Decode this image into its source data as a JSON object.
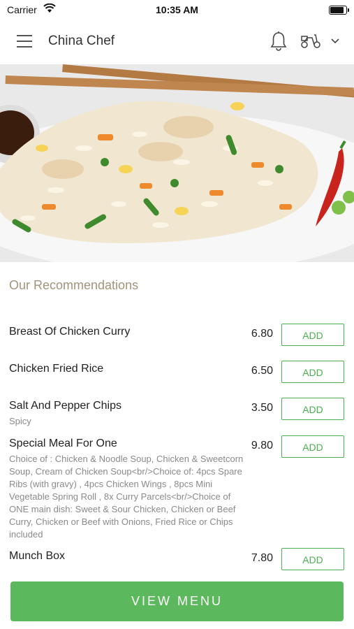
{
  "status_bar": {
    "carrier": "Carrier",
    "time": "10:35 AM"
  },
  "header": {
    "title": "China Chef"
  },
  "icons": {
    "menu": "hamburger-menu-icon",
    "notification": "bell-icon",
    "delivery": "scooter-icon",
    "dropdown": "chevron-down-icon",
    "wifi": "wifi-icon",
    "battery": "battery-icon"
  },
  "section_title": "Our Recommendations",
  "items": [
    {
      "name": "Breast Of Chicken Curry",
      "description": "",
      "price": "6.80",
      "action": "ADD"
    },
    {
      "name": "Chicken Fried Rice",
      "description": "",
      "price": "6.50",
      "action": "ADD"
    },
    {
      "name": "Salt And Pepper Chips",
      "description": "Spicy",
      "price": "3.50",
      "action": "ADD"
    },
    {
      "name": "Special Meal For One",
      "description": "Choice of : Chicken & Noodle Soup, Chicken & Sweetcorn Soup, Cream of Chicken Soup<br/>Choice of: 4pcs Spare Ribs (with gravy) , 4pcs Chicken Wings , 8pcs Mini Vegetable Spring Roll , 8x Curry Parcels<br/>Choice of ONE main dish: Sweet & Sour Chicken, Chicken or Beef Curry, Chicken or Beef with Onions, Fried Rice or Chips included",
      "price": "9.80",
      "action": "ADD"
    },
    {
      "name": "Munch Box",
      "description": "",
      "price": "7.80",
      "action": "ADD"
    }
  ],
  "view_menu_label": "VIEW MENU",
  "colors": {
    "accent_green": "#5cb85c",
    "add_border": "#4caf50",
    "section_title": "#a3937a"
  }
}
